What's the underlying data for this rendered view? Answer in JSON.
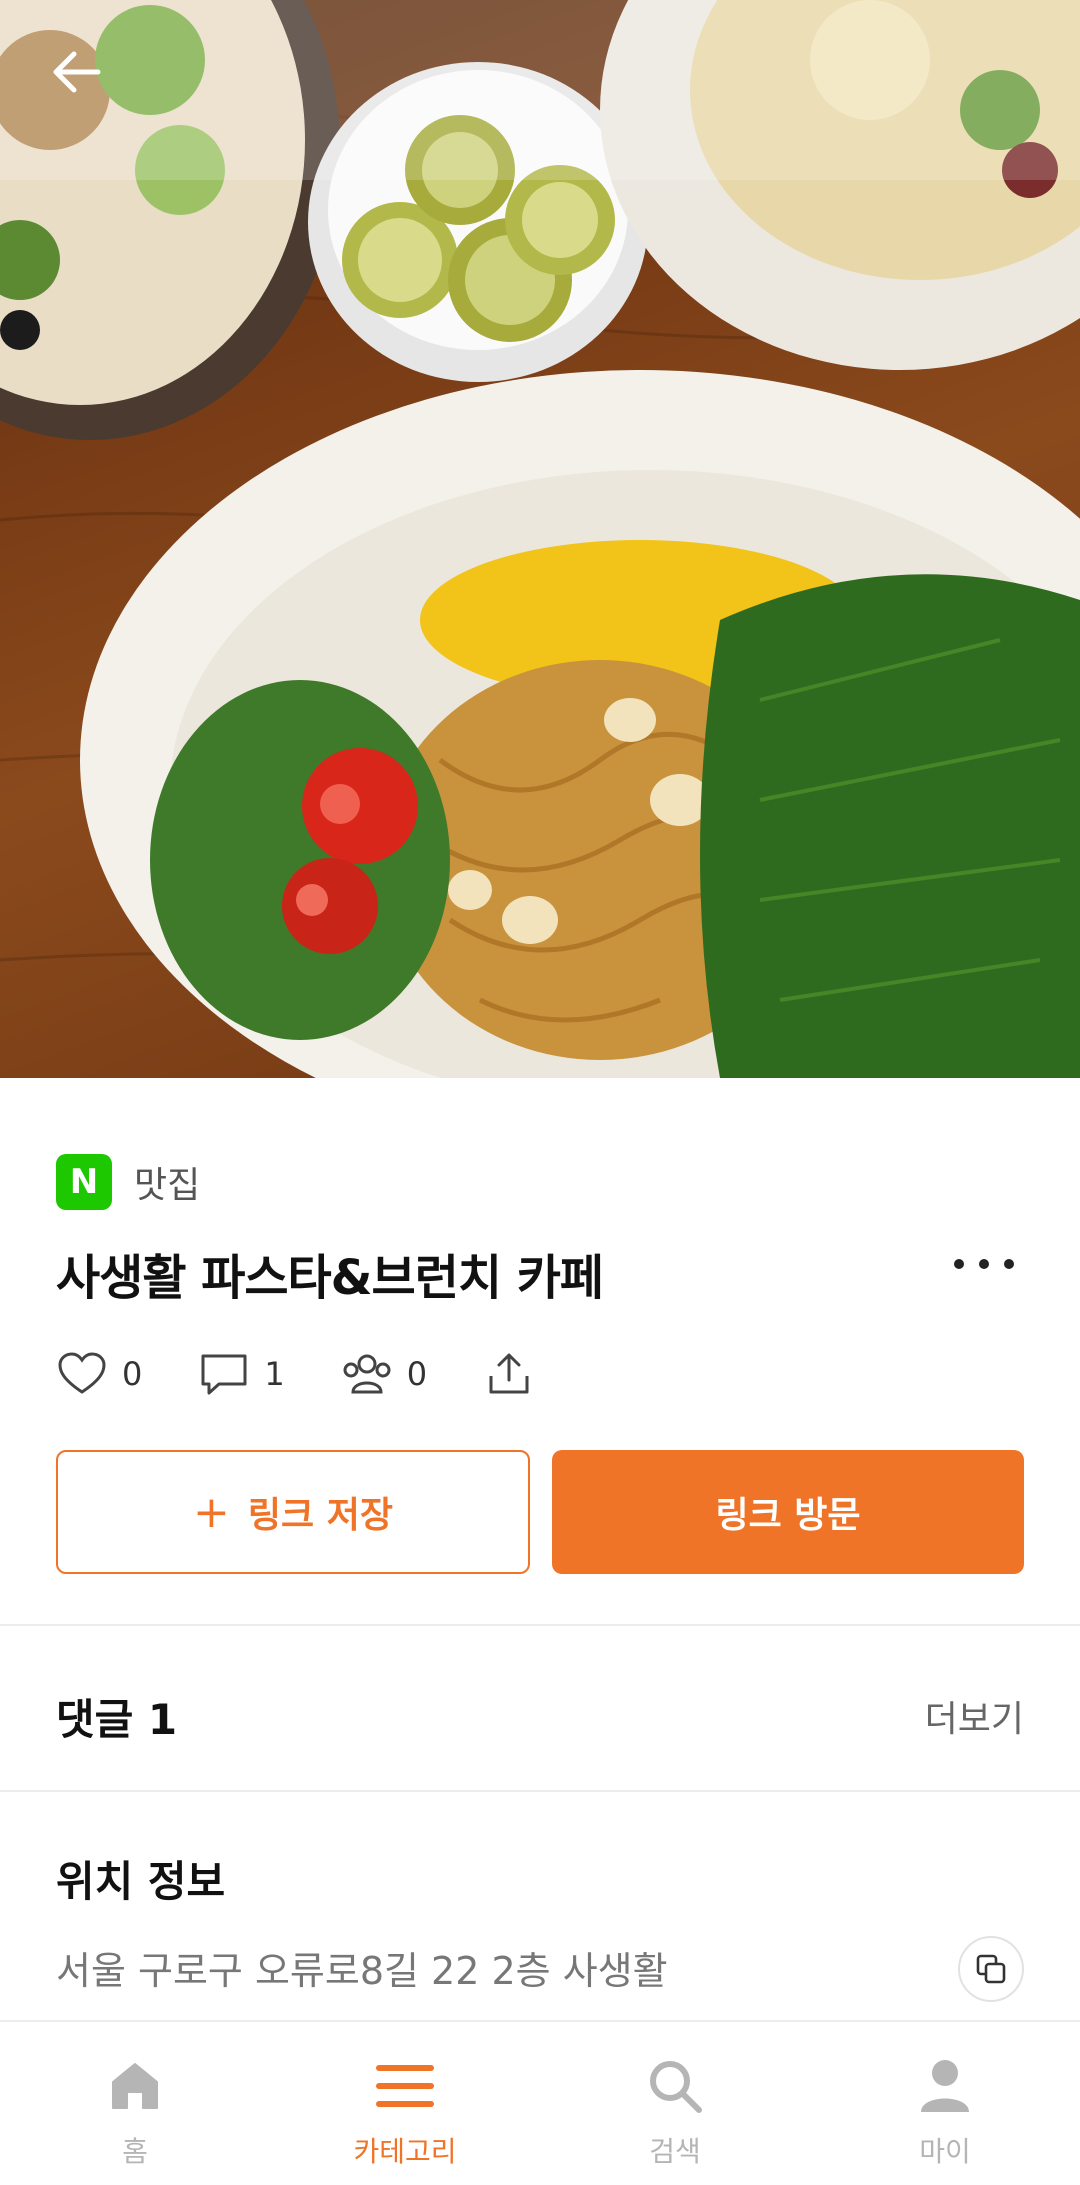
{
  "header": {
    "back_label": "back"
  },
  "post": {
    "category": "맛집",
    "source_badge": "N",
    "title": "사생활 파스타&브런치 카페",
    "likes": "0",
    "comments": "1",
    "shares": "0"
  },
  "actions": {
    "save_label": "링크 저장",
    "save_plus": "+",
    "visit_label": "링크 방문"
  },
  "comments_section": {
    "title": "댓글 1",
    "more_label": "더보기"
  },
  "location_section": {
    "title": "위치 정보",
    "address": "서울 구로구 오류로8길 22 2층 사생활"
  },
  "bottom_nav": {
    "items": [
      {
        "label": "홈",
        "icon": "home-icon"
      },
      {
        "label": "카테고리",
        "icon": "menu-icon"
      },
      {
        "label": "검색",
        "icon": "search-icon"
      },
      {
        "label": "마이",
        "icon": "user-icon"
      }
    ],
    "active_index": 1
  },
  "colors": {
    "accent": "#f07427",
    "naver_green": "#1ec800",
    "inactive": "#b5b5b5"
  }
}
